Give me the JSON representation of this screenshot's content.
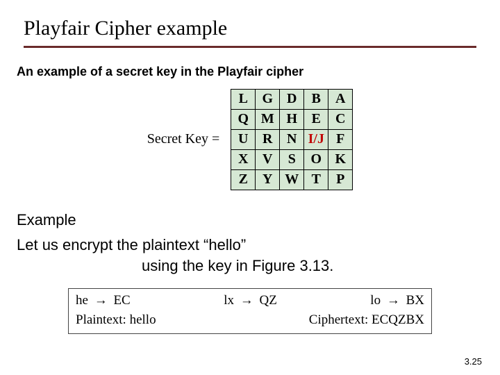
{
  "slide": {
    "title": "Playfair Cipher  example",
    "subtitle": "An example of a secret key in the Playfair cipher",
    "secret_key_label": "Secret Key =",
    "example_heading": "Example",
    "example_line1": "Let us encrypt the plaintext “hello”",
    "example_line2": "using the key in Figure 3.13.",
    "page_number": "3.25"
  },
  "key_table": {
    "rows": [
      [
        "L",
        "G",
        "D",
        "B",
        "A"
      ],
      [
        "Q",
        "M",
        "H",
        "E",
        "C"
      ],
      [
        "U",
        "R",
        "N",
        "I/J",
        "F"
      ],
      [
        "X",
        "V",
        "S",
        "O",
        "K"
      ],
      [
        "Z",
        "Y",
        "W",
        "T",
        "P"
      ]
    ],
    "red_cell": {
      "row": 2,
      "col": 3
    }
  },
  "cipher": {
    "mappings": [
      {
        "plain": "he",
        "cipher": "EC"
      },
      {
        "plain": "lx",
        "cipher": "QZ"
      },
      {
        "plain": "lo",
        "cipher": "BX"
      }
    ],
    "arrow": "→",
    "plain_label": "Plaintext: hello",
    "cipher_label": "Ciphertext: ECQZBX"
  }
}
